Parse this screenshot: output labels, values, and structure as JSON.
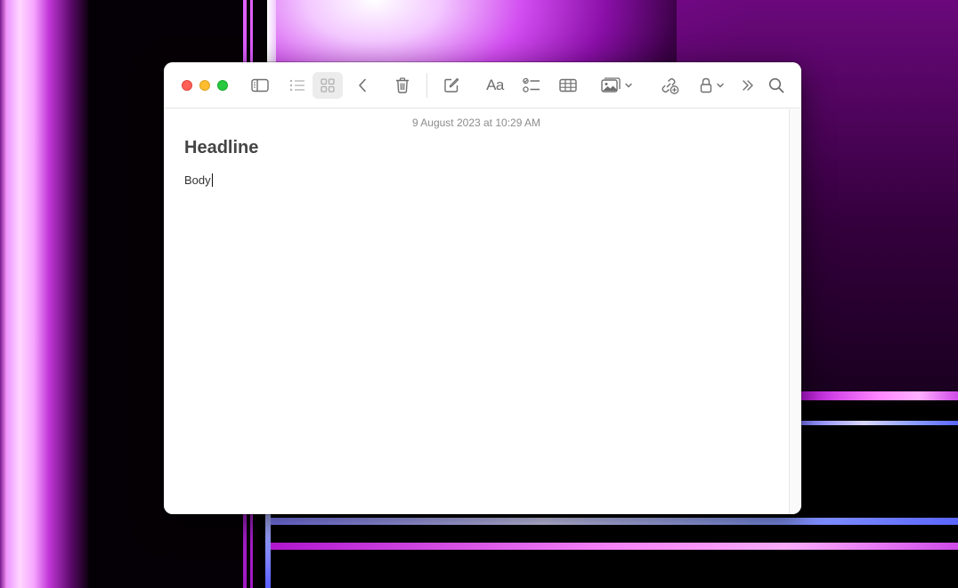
{
  "window": {
    "title_bar": {
      "buttons": [
        "close",
        "minimize",
        "zoom"
      ]
    },
    "toolbar": {
      "items": [
        {
          "name": "sidebar-toggle",
          "icon": "sidebar-icon"
        },
        {
          "name": "list-view",
          "icon": "list-icon"
        },
        {
          "name": "gallery-view",
          "icon": "grid-icon",
          "active": true
        },
        {
          "name": "back",
          "icon": "chevron-left-icon"
        },
        {
          "name": "delete",
          "icon": "trash-icon"
        },
        {
          "name": "new-note",
          "icon": "compose-icon"
        },
        {
          "name": "format",
          "icon": "text-format-icon",
          "label": "Aa"
        },
        {
          "name": "checklist",
          "icon": "checklist-icon"
        },
        {
          "name": "table",
          "icon": "table-icon"
        },
        {
          "name": "media",
          "icon": "photo-icon"
        },
        {
          "name": "collaborate",
          "icon": "link-add-icon"
        },
        {
          "name": "lock",
          "icon": "lock-icon"
        },
        {
          "name": "more",
          "icon": "chevron-double-right-icon"
        },
        {
          "name": "search",
          "icon": "search-icon"
        }
      ]
    }
  },
  "note": {
    "date": "9 August 2023 at 10:29 AM",
    "title": "Headline",
    "body": "Body"
  },
  "colors": {
    "close": "#ff5f57",
    "minimize": "#febc2e",
    "zoom": "#28c840",
    "icon": "#6e6e6e",
    "active_bg": "#ececec"
  }
}
